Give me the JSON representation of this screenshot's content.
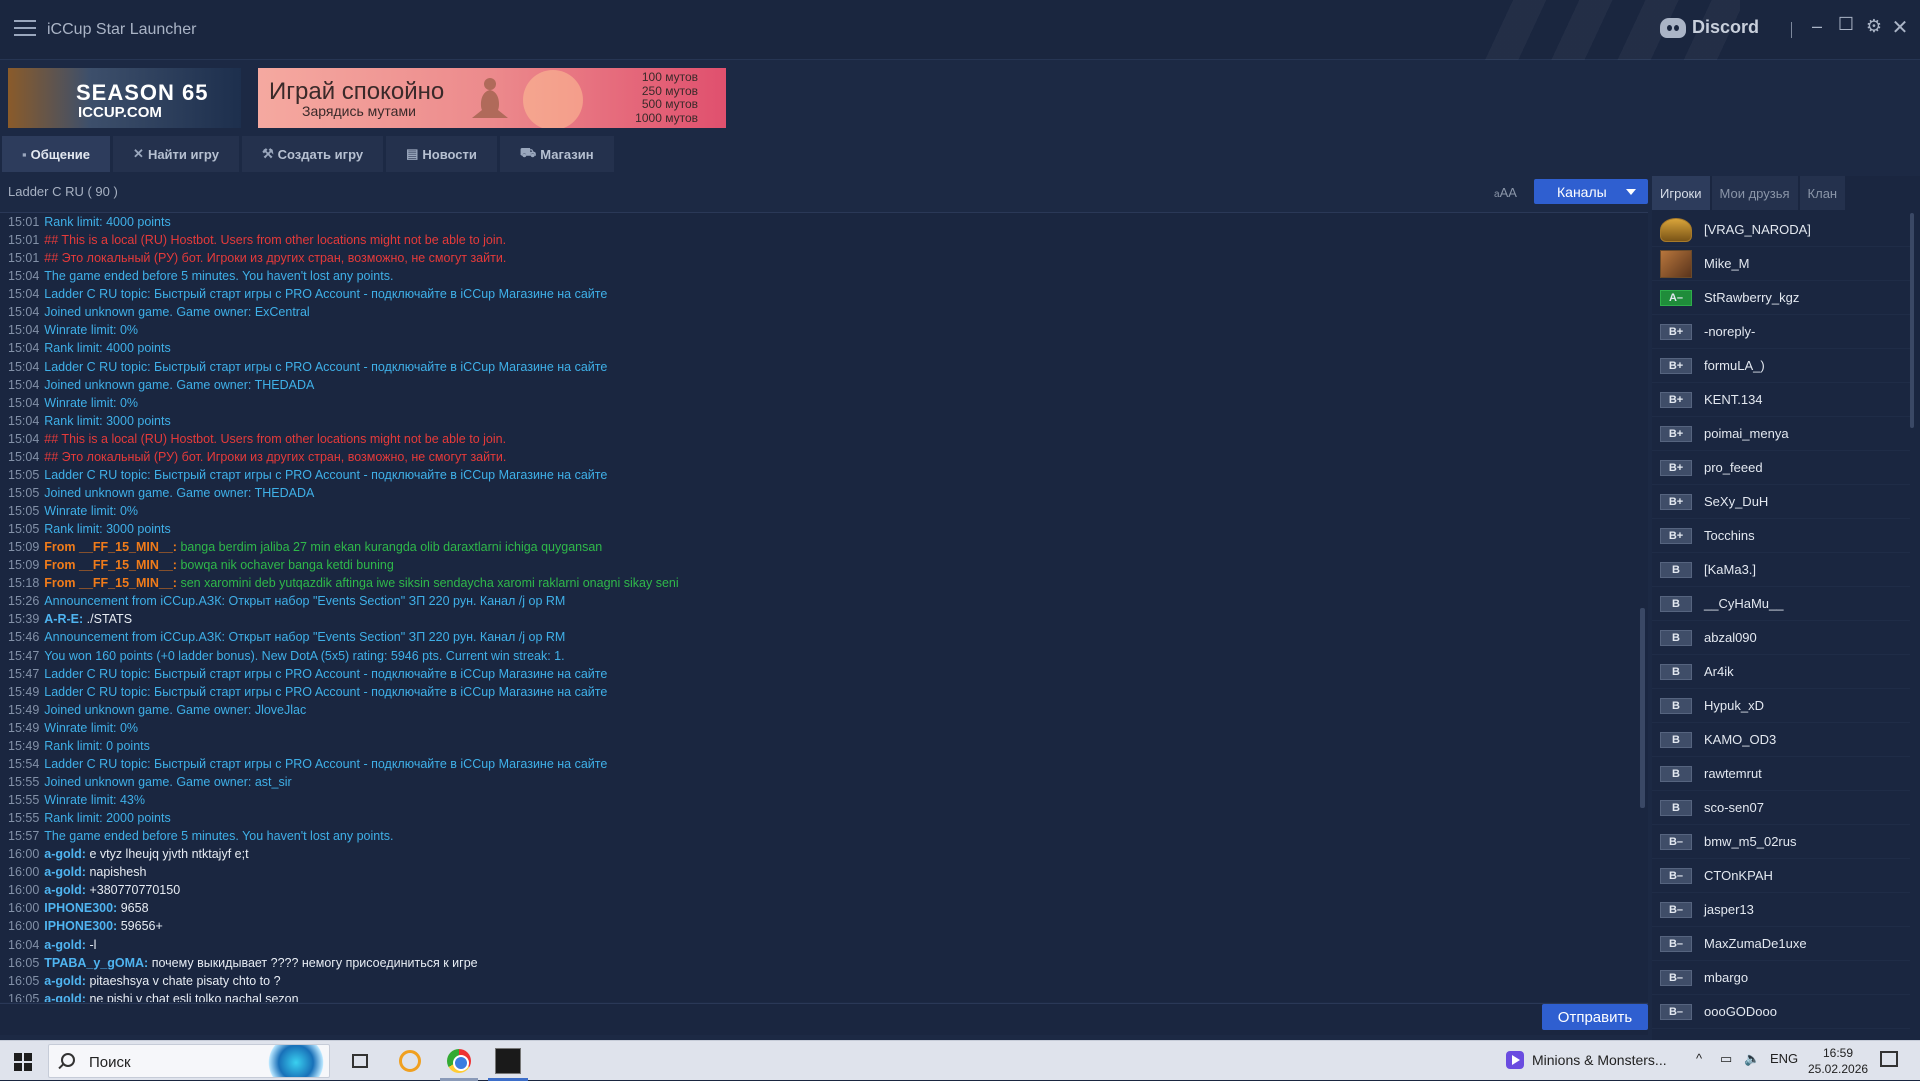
{
  "window": {
    "title": "iCCup Star Launcher",
    "discord_label": "Discord"
  },
  "banners": {
    "season": {
      "big": "SEASON 65",
      "small": "ICCUP.COM"
    },
    "promo": {
      "big": "Играй спокойно",
      "small": "Зарядись мутами",
      "lines": [
        "100 мутов",
        "250 мутов",
        "500 мутов",
        "1000 мутов"
      ]
    }
  },
  "tabs": [
    {
      "label": "Общение",
      "icon": "chat-icon"
    },
    {
      "label": "Найти игру",
      "icon": "swords-icon"
    },
    {
      "label": "Создать игру",
      "icon": "hammer-icon"
    },
    {
      "label": "Новости",
      "icon": "news-icon"
    },
    {
      "label": "Магазин",
      "icon": "cart-icon"
    }
  ],
  "channel": {
    "name": "Ladder C RU  ( 90 )",
    "font_ctrl_small": "a",
    "font_ctrl_big": "AA",
    "channels_button": "Каналы"
  },
  "chat": [
    {
      "t": "15:01",
      "type": "system",
      "msg": "Rank limit: 4000 points"
    },
    {
      "t": "15:01",
      "type": "red",
      "msg": "## This is a local (RU) Hostbot. Users from other locations might not be able to join."
    },
    {
      "t": "15:01",
      "type": "red",
      "msg": "## Это локальный (РУ) бот. Игроки из других стран, возможно, не смогут зайти."
    },
    {
      "t": "15:04",
      "type": "system",
      "msg": "The game ended before 5 minutes. You haven't lost any points."
    },
    {
      "t": "15:04",
      "type": "system",
      "msg": "Ladder C RU topic: Быстрый старт игры с PRO Account - подключайте в iCCup Магазине на сайте"
    },
    {
      "t": "15:04",
      "type": "system",
      "msg": "Joined unknown game. Game owner: ExCentral"
    },
    {
      "t": "15:04",
      "type": "system",
      "msg": "Winrate limit: 0%"
    },
    {
      "t": "15:04",
      "type": "system",
      "msg": "Rank limit: 4000 points"
    },
    {
      "t": "15:04",
      "type": "system",
      "msg": "Ladder C RU topic: Быстрый старт игры с PRO Account - подключайте в iCCup Магазине на сайте"
    },
    {
      "t": "15:04",
      "type": "system",
      "msg": "Joined unknown game. Game owner: THEDADA"
    },
    {
      "t": "15:04",
      "type": "system",
      "msg": "Winrate limit: 0%"
    },
    {
      "t": "15:04",
      "type": "system",
      "msg": "Rank limit: 3000 points"
    },
    {
      "t": "15:04",
      "type": "red",
      "msg": "## This is a local (RU) Hostbot. Users from other locations might not be able to join."
    },
    {
      "t": "15:04",
      "type": "red",
      "msg": "## Это локальный (РУ) бот. Игроки из других стран, возможно, не смогут зайти."
    },
    {
      "t": "15:05",
      "type": "system",
      "msg": "Ladder C RU topic: Быстрый старт игры с PRO Account - подключайте в iCCup Магазине на сайте"
    },
    {
      "t": "15:05",
      "type": "system",
      "msg": "Joined unknown game. Game owner: THEDADA"
    },
    {
      "t": "15:05",
      "type": "system",
      "msg": "Winrate limit: 0%"
    },
    {
      "t": "15:05",
      "type": "system",
      "msg": "Rank limit: 3000 points"
    },
    {
      "t": "15:09",
      "type": "whisper",
      "nick": "From __FF_15_MIN__:",
      "msg": "banga berdim jaliba 27 min ekan kurangda olib daraxtlarni ichiga quygansan"
    },
    {
      "t": "15:09",
      "type": "whisper",
      "nick": "From __FF_15_MIN__:",
      "msg": "bowqa nik ochaver banga ketdi buning"
    },
    {
      "t": "15:18",
      "type": "whisper",
      "nick": "From __FF_15_MIN__:",
      "msg": "sen xaromini deb yutqazdik aftinga iwe siksin sendaycha xaromi raklarni onagni sikay  seni"
    },
    {
      "t": "15:26",
      "type": "system",
      "msg": "Announcement from iCCup.АЗК: Открыт набор \"Events Section\" ЗП 220 рун. Канал /j op RM"
    },
    {
      "t": "15:39",
      "type": "user",
      "nick": "A-R-E:",
      "msg": "./STATS"
    },
    {
      "t": "15:46",
      "type": "system",
      "msg": "Announcement from iCCup.АЗК: Открыт набор \"Events Section\" ЗП 220 рун. Канал /j op RM"
    },
    {
      "t": "15:47",
      "type": "system",
      "msg": "You won 160 points (+0 ladder bonus). New DotA (5x5) rating: 5946 pts. Current win streak: 1."
    },
    {
      "t": "15:47",
      "type": "system",
      "msg": "Ladder C RU topic: Быстрый старт игры с PRO Account - подключайте в iCCup Магазине на сайте"
    },
    {
      "t": "15:49",
      "type": "system",
      "msg": "Ladder C RU topic: Быстрый старт игры с PRO Account - подключайте в iCCup Магазине на сайте"
    },
    {
      "t": "15:49",
      "type": "system",
      "msg": "Joined unknown game. Game owner: JloveJlac"
    },
    {
      "t": "15:49",
      "type": "system",
      "msg": "Winrate limit: 0%"
    },
    {
      "t": "15:49",
      "type": "system",
      "msg": "Rank limit: 0 points"
    },
    {
      "t": "15:54",
      "type": "system",
      "msg": "Ladder C RU topic: Быстрый старт игры с PRO Account - подключайте в iCCup Магазине на сайте"
    },
    {
      "t": "15:55",
      "type": "system",
      "msg": "Joined unknown game. Game owner: ast_sir"
    },
    {
      "t": "15:55",
      "type": "system",
      "msg": "Winrate limit: 43%"
    },
    {
      "t": "15:55",
      "type": "system",
      "msg": "Rank limit: 2000 points"
    },
    {
      "t": "15:57",
      "type": "system",
      "msg": "The game ended before 5 minutes. You haven't lost any points."
    },
    {
      "t": "16:00",
      "type": "user",
      "nick": "a-gold:",
      "msg": "e vtyz lheujq yjvth ntktajyf e;t"
    },
    {
      "t": "16:00",
      "type": "user",
      "nick": "a-gold:",
      "msg": "napishesh"
    },
    {
      "t": "16:00",
      "type": "user",
      "nick": "a-gold:",
      "msg": "+380770770150"
    },
    {
      "t": "16:00",
      "type": "user",
      "nick": "IPHONE300:",
      "msg": "9658"
    },
    {
      "t": "16:00",
      "type": "user",
      "nick": "IPHONE300:",
      "msg": "59656+"
    },
    {
      "t": "16:04",
      "type": "user",
      "nick": "a-gold:",
      "msg": "-l"
    },
    {
      "t": "16:05",
      "type": "user",
      "nick": "TPABA_y_gOMA:",
      "msg": "почему выкидывает ???? немогу присоединиться к игре"
    },
    {
      "t": "16:05",
      "type": "user",
      "nick": "a-gold:",
      "msg": "pitaeshsya v chate pisaty chto to ?"
    },
    {
      "t": "16:05",
      "type": "user",
      "nick": "a-gold:",
      "msg": "ne pishi v chat esli tolko nachal sezon"
    }
  ],
  "input": {
    "send_button": "Отправить"
  },
  "right_panel": {
    "tabs": [
      "Игроки",
      "Мои друзья",
      "Клан"
    ],
    "players": [
      {
        "name": "[VRAG_NARODA]",
        "badge": "",
        "style": "emblem"
      },
      {
        "name": "Mike_M",
        "badge": "",
        "style": "avatar"
      },
      {
        "name": "StRawberry_kgz",
        "badge": "A–",
        "style": "green"
      },
      {
        "name": "-noreply-",
        "badge": "B+",
        "style": "grey"
      },
      {
        "name": "formuLA_)",
        "badge": "B+",
        "style": "grey"
      },
      {
        "name": "KENT.134",
        "badge": "B+",
        "style": "grey"
      },
      {
        "name": "poimai_menya",
        "badge": "B+",
        "style": "grey"
      },
      {
        "name": "pro_feeed",
        "badge": "B+",
        "style": "grey"
      },
      {
        "name": "SeXy_DuH",
        "badge": "B+",
        "style": "grey"
      },
      {
        "name": "Tocchins",
        "badge": "B+",
        "style": "grey"
      },
      {
        "name": "[KaMa3.]",
        "badge": "B",
        "style": "grey"
      },
      {
        "name": "__CyHaMu__",
        "badge": "B",
        "style": "grey"
      },
      {
        "name": "abzal090",
        "badge": "B",
        "style": "grey"
      },
      {
        "name": "Ar4ik",
        "badge": "B",
        "style": "grey"
      },
      {
        "name": "Hypuk_xD",
        "badge": "B",
        "style": "grey"
      },
      {
        "name": "KAMO_OD3",
        "badge": "B",
        "style": "grey"
      },
      {
        "name": "rawtemrut",
        "badge": "B",
        "style": "grey"
      },
      {
        "name": "sco-sen07",
        "badge": "B",
        "style": "grey"
      },
      {
        "name": "bmw_m5_02rus",
        "badge": "B–",
        "style": "grey"
      },
      {
        "name": "CTOnKPAH",
        "badge": "B–",
        "style": "grey"
      },
      {
        "name": "jasper13",
        "badge": "B–",
        "style": "grey"
      },
      {
        "name": "MaxZumaDe1uxe",
        "badge": "B–",
        "style": "grey"
      },
      {
        "name": "mbargo",
        "badge": "B–",
        "style": "grey"
      },
      {
        "name": "oooGODooo",
        "badge": "B–",
        "style": "grey"
      }
    ]
  },
  "taskbar": {
    "search_placeholder": "Поиск",
    "media_title": "Minions & Monsters...",
    "lang": "ENG",
    "time": "16:59",
    "date": "25.02.2026"
  },
  "colors": {
    "accent_button": "#2f5fd0",
    "system_text": "#3fb0e8",
    "warning_text": "#e53a3a",
    "whisper_nick": "#f07b1a",
    "whisper_text": "#2fb84a"
  }
}
